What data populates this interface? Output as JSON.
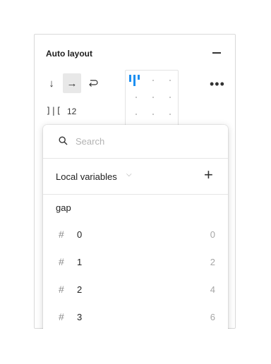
{
  "panel": {
    "title": "Auto layout",
    "collapse_icon": "minus-icon",
    "direction_icons": [
      "arrow-down-icon",
      "arrow-right-icon",
      "wrap-icon"
    ],
    "active_direction": "horizontal",
    "more_icon": "ellipsis-icon",
    "gap_value": "12"
  },
  "dropdown": {
    "search": {
      "placeholder": "Search"
    },
    "library_label": "Local variables",
    "collection_label": "gap",
    "variables": [
      {
        "name": "0",
        "value": "0"
      },
      {
        "name": "1",
        "value": "2"
      },
      {
        "name": "2",
        "value": "4"
      },
      {
        "name": "3",
        "value": "6"
      }
    ]
  },
  "colors": {
    "accent": "#1d8ff0",
    "border": "#d9d9d9",
    "active_bg": "#e8e8e8"
  }
}
